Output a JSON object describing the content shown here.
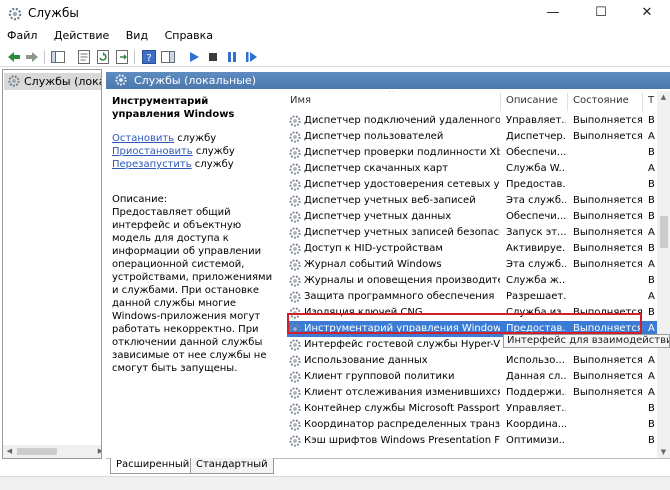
{
  "window": {
    "title": "Службы",
    "minimize": "—",
    "maximize": "☐",
    "close": "✕"
  },
  "menu": [
    "Файл",
    "Действие",
    "Вид",
    "Справка"
  ],
  "tree": {
    "item_label": "Службы (локалы"
  },
  "pane_header": "Службы (локальные)",
  "details": {
    "service_title": "Инструментарий управления Windows",
    "actions": [
      {
        "link": "Остановить",
        "rest": " службу"
      },
      {
        "link": "Приостановить",
        "rest": " службу"
      },
      {
        "link": "Перезапустить",
        "rest": " службу"
      }
    ],
    "description_label": "Описание:",
    "description_text": "Предоставляет общий интерфейс и объектную модель для доступа к информации об управлении операционной системой, устройствами, приложениями и службами. При остановке данной службы многие Windows-приложения могут работать некорректно. При отключении данной службы зависимые от нее службы не смогут быть запущены."
  },
  "columns": {
    "name": "Имя",
    "description": "Описание",
    "status": "Состояние",
    "startup": "Т"
  },
  "rows": [
    {
      "name": "Диспетчер подключений удаленного дос...",
      "desc": "Управляет...",
      "status": "Выполняется",
      "startup": "В"
    },
    {
      "name": "Диспетчер пользователей",
      "desc": "Диспетчер...",
      "status": "Выполняется",
      "startup": "А"
    },
    {
      "name": "Диспетчер проверки подлинности Xbox ...",
      "desc": "Обеспечи...",
      "status": "",
      "startup": "В"
    },
    {
      "name": "Диспетчер скачанных карт",
      "desc": "Служба W...",
      "status": "",
      "startup": "А"
    },
    {
      "name": "Диспетчер удостоверения сетевых участ...",
      "desc": "Предостав...",
      "status": "",
      "startup": "В"
    },
    {
      "name": "Диспетчер учетных веб-записей",
      "desc": "Эта служб...",
      "status": "Выполняется",
      "startup": "В"
    },
    {
      "name": "Диспетчер учетных данных",
      "desc": "Обеспечи...",
      "status": "Выполняется",
      "startup": "В"
    },
    {
      "name": "Диспетчер учетных записей безопасности",
      "desc": "Запуск эт...",
      "status": "Выполняется",
      "startup": "А"
    },
    {
      "name": "Доступ к HID-устройствам",
      "desc": "Активируе...",
      "status": "Выполняется",
      "startup": "В"
    },
    {
      "name": "Журнал событий Windows",
      "desc": "Эта служб...",
      "status": "Выполняется",
      "startup": "А"
    },
    {
      "name": "Журналы и оповещения производитель...",
      "desc": "Служба ж...",
      "status": "",
      "startup": "В"
    },
    {
      "name": "Защита программного обеспечения",
      "desc": "Разрешает...",
      "status": "",
      "startup": "А"
    },
    {
      "name": "Изоляция ключей CNG",
      "desc": "Служба из...",
      "status": "Выполняется",
      "startup": "В"
    },
    {
      "name": "Инструментарий управления Windows",
      "desc": "Предостав...",
      "status": "Выполняется",
      "startup": "А",
      "selected": true
    },
    {
      "name": "Интерфейс гостевой службы Hyper-V",
      "desc": "",
      "status": "",
      "startup": "В"
    },
    {
      "name": "Использование данных",
      "desc": "Использо...",
      "status": "Выполняется",
      "startup": "А"
    },
    {
      "name": "Клиент групповой политики",
      "desc": "Данная сл...",
      "status": "Выполняется",
      "startup": "А"
    },
    {
      "name": "Клиент отслеживания изменившихся свя",
      "desc": "Поддержи...",
      "status": "Выполняется",
      "startup": "А"
    },
    {
      "name": "Контейнер службы Microsoft Passport",
      "desc": "Управляет...",
      "status": "",
      "startup": "В"
    },
    {
      "name": "Координатор распределенных транзакций",
      "desc": "Координа...",
      "status": "",
      "startup": "В"
    },
    {
      "name": "Кэш шрифтов Windows Presentation Fou...",
      "desc": "Оптимизи...",
      "status": "",
      "startup": "В"
    }
  ],
  "tooltip": "Интерфейс для взаимодействия узл",
  "tabs": [
    "Расширенный",
    "Стандартный"
  ],
  "colors": {
    "header_blue": "#4a77ac",
    "selection_blue": "#3a7bd5",
    "highlight_red": "#d21f2a",
    "link_blue": "#2e58b8"
  }
}
